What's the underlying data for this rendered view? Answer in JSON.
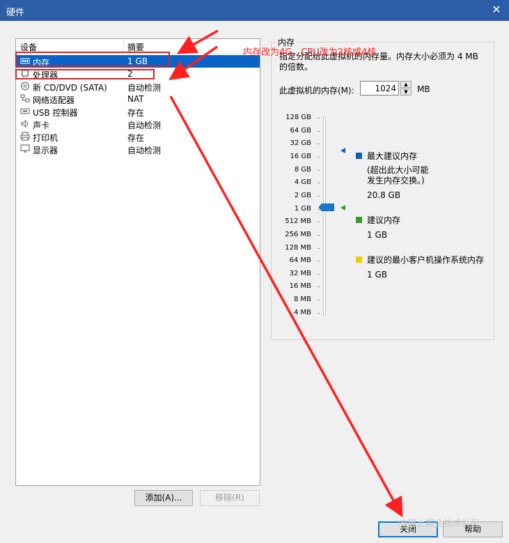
{
  "window": {
    "title": "硬件",
    "close_glyph": "✕"
  },
  "device_list": {
    "col_device": "设备",
    "col_summary": "摘要",
    "rows": [
      {
        "name": "内存",
        "summary": "1 GB",
        "icon": "memory-icon",
        "selected": true
      },
      {
        "name": "处理器",
        "summary": "2",
        "icon": "processor-icon",
        "selected": false
      },
      {
        "name": "新 CD/DVD (SATA)",
        "summary": "自动检测",
        "icon": "cd-dvd-icon",
        "selected": false
      },
      {
        "name": "网络适配器",
        "summary": "NAT",
        "icon": "network-adapter-icon",
        "selected": false
      },
      {
        "name": "USB 控制器",
        "summary": "存在",
        "icon": "usb-controller-icon",
        "selected": false
      },
      {
        "name": "声卡",
        "summary": "自动检测",
        "icon": "sound-card-icon",
        "selected": false
      },
      {
        "name": "打印机",
        "summary": "存在",
        "icon": "printer-icon",
        "selected": false
      },
      {
        "name": "显示器",
        "summary": "自动检测",
        "icon": "display-icon",
        "selected": false
      }
    ],
    "add_label": "添加(A)...",
    "remove_label": "移除(R)"
  },
  "memory": {
    "legend": "内存",
    "description": "指定分配给此虚拟机的内存量。内存大小必须为 4 MB 的倍数。",
    "field_label": "此虚拟机的内存(M):",
    "value": "1024",
    "unit": "MB",
    "scale_labels": [
      "128 GB",
      "64 GB",
      "32 GB",
      "16 GB",
      "8 GB",
      "4 GB",
      "2 GB",
      "1 GB",
      "512 MB",
      "256 MB",
      "128 MB",
      "64 MB",
      "32 MB",
      "16 MB",
      "8 MB",
      "4 MB"
    ],
    "current_level": "1 GB",
    "max_recommended": {
      "title": "最大建议内存",
      "note_line1": "(超出此大小可能",
      "note_line2": "发生内存交换。)",
      "value": "20.8 GB",
      "color": "#1060b0"
    },
    "recommended": {
      "title": "建议内存",
      "value": "1 GB",
      "color": "#3a9a2a"
    },
    "min_guest": {
      "title": "建议的最小客户机操作系统内存",
      "value": "1 GB",
      "color": "#f0d000"
    }
  },
  "footer": {
    "close_label": "关闭",
    "help_label": "帮助"
  },
  "annotation": {
    "text": "内存改为4G，CPU改为2核或4核",
    "color": "#ff2020"
  },
  "watermark": "@稀土掘金技术社区",
  "colors": {
    "titlebar": "#2b5ea7",
    "selection": "#0a64c8",
    "accent": "#0078d7"
  }
}
